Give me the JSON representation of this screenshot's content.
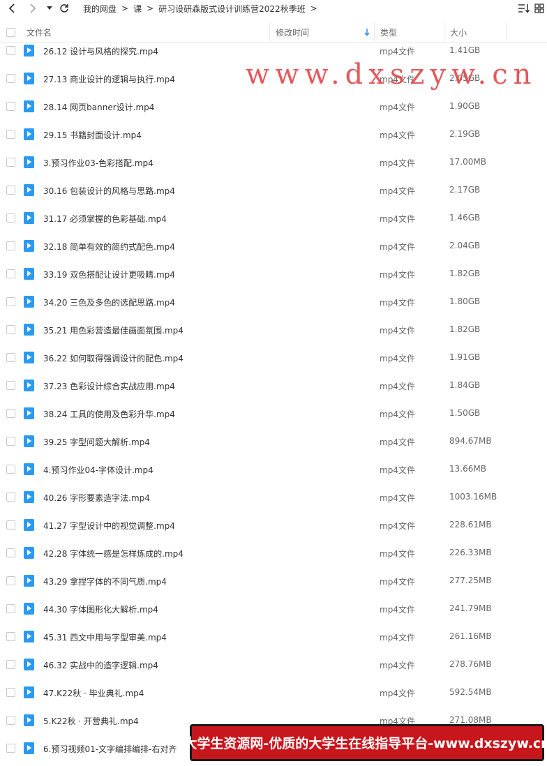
{
  "toolbar": {
    "back_icon": "chevron-left-icon",
    "forward_icon": "chevron-right-icon",
    "dropdown_icon": "caret-down-icon",
    "refresh_icon": "refresh-icon",
    "sort_icon": "sort-lines-icon",
    "grid_icon": "grid-view-icon"
  },
  "breadcrumb": [
    "我的网盘",
    "课",
    "研习设研森版式设计训练营2022秋季班"
  ],
  "header": {
    "name": "文件名",
    "modified": "修改时间",
    "type": "类型",
    "size": "大小"
  },
  "files": [
    {
      "name": "26.12 设计与风格的探究.mp4",
      "type": "mp4文件",
      "size": "1.41GB"
    },
    {
      "name": "27.13 商业设计的逻辑与执行.mp4",
      "type": "mp4文件",
      "size": "2.05GB"
    },
    {
      "name": "28.14 网页banner设计.mp4",
      "type": "mp4文件",
      "size": "1.90GB"
    },
    {
      "name": "29.15 书籍封面设计.mp4",
      "type": "mp4文件",
      "size": "2.19GB"
    },
    {
      "name": "3.预习作业03-色彩搭配.mp4",
      "type": "mp4文件",
      "size": "17.00MB"
    },
    {
      "name": "30.16 包装设计的风格与思路.mp4",
      "type": "mp4文件",
      "size": "2.17GB"
    },
    {
      "name": "31.17 必须掌握的色彩基础.mp4",
      "type": "mp4文件",
      "size": "1.46GB"
    },
    {
      "name": "32.18 简单有效的简约式配色.mp4",
      "type": "mp4文件",
      "size": "2.04GB"
    },
    {
      "name": "33.19 双色搭配让设计更吸睛.mp4",
      "type": "mp4文件",
      "size": "1.82GB"
    },
    {
      "name": "34.20 三色及多色的选配思路.mp4",
      "type": "mp4文件",
      "size": "1.80GB"
    },
    {
      "name": "35.21 用色彩营造最佳画面氛围.mp4",
      "type": "mp4文件",
      "size": "1.82GB"
    },
    {
      "name": "36.22 如何取得强调设计的配色.mp4",
      "type": "mp4文件",
      "size": "1.91GB"
    },
    {
      "name": "37.23 色彩设计综合实战应用.mp4",
      "type": "mp4文件",
      "size": "1.84GB"
    },
    {
      "name": "38.24 工具的使用及色彩升华.mp4",
      "type": "mp4文件",
      "size": "1.50GB"
    },
    {
      "name": "39.25 字型问题大解析.mp4",
      "type": "mp4文件",
      "size": "894.67MB"
    },
    {
      "name": "4.预习作业04-字体设计.mp4",
      "type": "mp4文件",
      "size": "13.66MB"
    },
    {
      "name": "40.26 字形要素造字法.mp4",
      "type": "mp4文件",
      "size": "1003.16MB"
    },
    {
      "name": "41.27 字型设计中的视觉调整.mp4",
      "type": "mp4文件",
      "size": "228.61MB"
    },
    {
      "name": "42.28 字体统一感是怎样炼成的.mp4",
      "type": "mp4文件",
      "size": "226.33MB"
    },
    {
      "name": "43.29 拿捏字体的不同气质.mp4",
      "type": "mp4文件",
      "size": "277.25MB"
    },
    {
      "name": "44.30 字体图形化大解析.mp4",
      "type": "mp4文件",
      "size": "241.79MB"
    },
    {
      "name": "45.31 西文中用与字型审美.mp4",
      "type": "mp4文件",
      "size": "261.16MB"
    },
    {
      "name": "46.32 实战中的造字逻辑.mp4",
      "type": "mp4文件",
      "size": "278.76MB"
    },
    {
      "name": "47.K22秋 · 毕业典礼.mp4",
      "type": "mp4文件",
      "size": "592.54MB"
    },
    {
      "name": "5.K22秋 · 开营典礼.mp4",
      "type": "mp4文件",
      "size": "271.08MB"
    },
    {
      "name": "6.预习视频01-文字编排编排-右对齐",
      "type": "",
      "size": ""
    }
  ],
  "watermark": "www.dxszyw.cn",
  "banner": "大学生资源网-优质的大学生在线指导平台-www.dxszyw.cn",
  "colors": {
    "file_icon": "#2a9af3",
    "watermark": "#e0484a",
    "banner_bg": "#c8161d",
    "sort_arrow": "#2a8ae8"
  }
}
